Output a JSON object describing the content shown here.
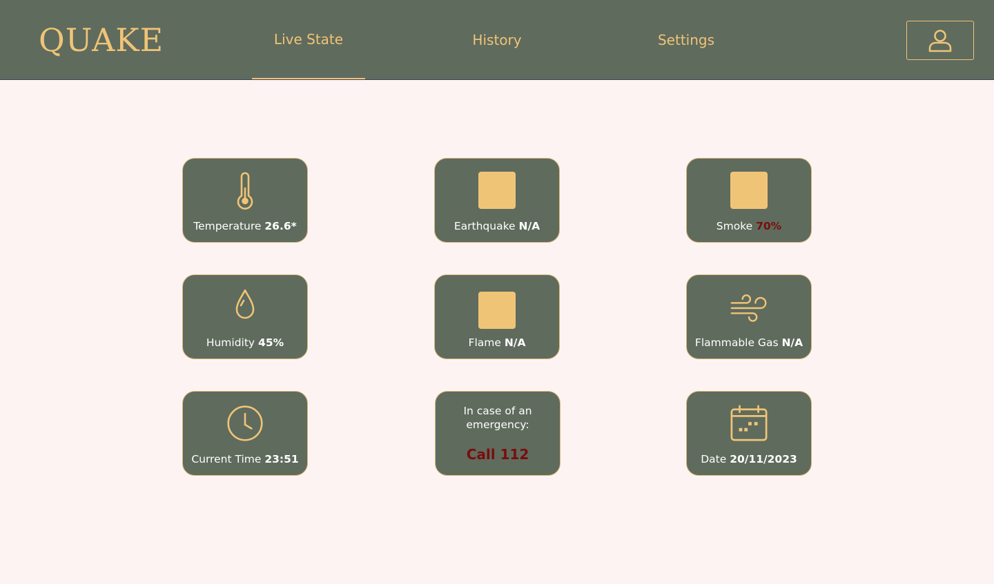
{
  "app": {
    "name": "QUAKE"
  },
  "nav": {
    "tabs": [
      {
        "label": "Live State",
        "active": true
      },
      {
        "label": "History",
        "active": false
      },
      {
        "label": "Settings",
        "active": false
      }
    ],
    "profile_icon": "user-icon"
  },
  "colors": {
    "header_bg": "#5f6b5d",
    "accent": "#f0c477",
    "page_bg": "#fdf3f2",
    "alert": "#7a0d0d"
  },
  "cards": {
    "temperature": {
      "label": "Temperature",
      "value": "26.6*",
      "icon": "thermometer-icon"
    },
    "earthquake": {
      "label": "Earthquake",
      "value": "N/A",
      "icon": "status-square-icon"
    },
    "smoke": {
      "label": "Smoke",
      "value": "70%",
      "icon": "status-square-icon",
      "status": "alert"
    },
    "humidity": {
      "label": "Humidity",
      "value": "45%",
      "icon": "droplet-icon"
    },
    "flame": {
      "label": "Flame",
      "value": "N/A",
      "icon": "status-square-icon"
    },
    "flammable_gas": {
      "label": "Flammable Gas",
      "value": "N/A",
      "icon": "wind-icon"
    },
    "current_time": {
      "label": "Current Time",
      "value": "23:51",
      "icon": "clock-icon"
    },
    "emergency": {
      "line1": "In case of an",
      "line2": "emergency:",
      "call": "Call 112"
    },
    "date": {
      "label": "Date",
      "value": "20/11/2023",
      "icon": "calendar-icon"
    }
  }
}
